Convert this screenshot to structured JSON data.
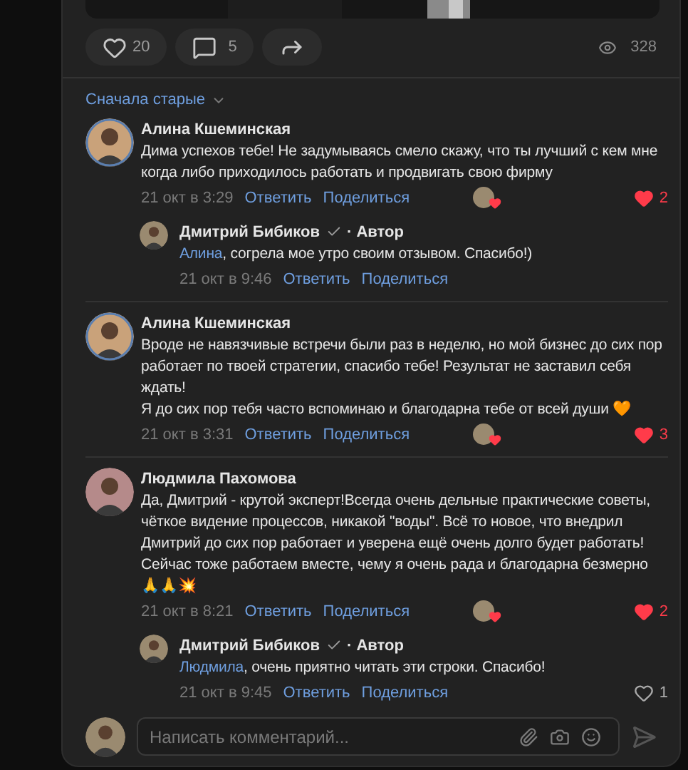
{
  "post": {
    "likes": "20",
    "comments": "5",
    "views": "328"
  },
  "sort": {
    "label": "Сначала старые"
  },
  "comments": [
    {
      "name": "Алина Кшеминская",
      "text": "Дима успехов тебе! Не задумываясь смело скажу, что ты лучший с кем мне когда либо приходилось работать и продвигать свою фирму",
      "time": "21 окт в 3:29",
      "reply": "Ответить",
      "share": "Поделиться",
      "likes": "2",
      "liked": true,
      "author_liked": true,
      "replies": [
        {
          "name": "Дмитрий Бибиков",
          "badge": "· Автор",
          "verified": true,
          "mention": "Алина",
          "text": ", согрела мое утро своим отзывом. Спасибо!)",
          "time": "21 окт в 9:46",
          "reply": "Ответить",
          "share": "Поделиться"
        }
      ]
    },
    {
      "name": "Алина Кшеминская",
      "text": "Вроде не навязчивые встречи были раз в неделю, но мой бизнес до сих пор работает по твоей стратегии, спасибо тебе! Результат не заставил себя ждать!\nЯ до сих пор тебя часто вспоминаю и благодарна тебе от всей души 🧡",
      "time": "21 окт в 3:31",
      "reply": "Ответить",
      "share": "Поделиться",
      "likes": "3",
      "liked": true,
      "author_liked": true
    },
    {
      "name": "Людмила Пахомова",
      "text": "Да, Дмитрий - крутой эксперт!Всегда очень дельные практические советы, чёткое видение процессов, никакой \"воды\". Всё то новое, что внедрил Дмитрий до сих пор работает и уверена ещё очень долго будет работать! Сейчас тоже работаем вместе, чему я очень рада и благодарна безмерно\n🙏🙏💥",
      "time": "21 окт в 8:21",
      "reply": "Ответить",
      "share": "Поделиться",
      "likes": "2",
      "liked": true,
      "author_liked": true,
      "replies": [
        {
          "name": "Дмитрий Бибиков",
          "badge": "· Автор",
          "verified": true,
          "mention": "Людмила",
          "text": ", очень приятно читать эти строки. Спасибо!",
          "time": "21 окт в 9:45",
          "reply": "Ответить",
          "share": "Поделиться",
          "likes": "1",
          "liked": false
        }
      ]
    }
  ],
  "composer": {
    "placeholder": "Написать комментарий..."
  }
}
